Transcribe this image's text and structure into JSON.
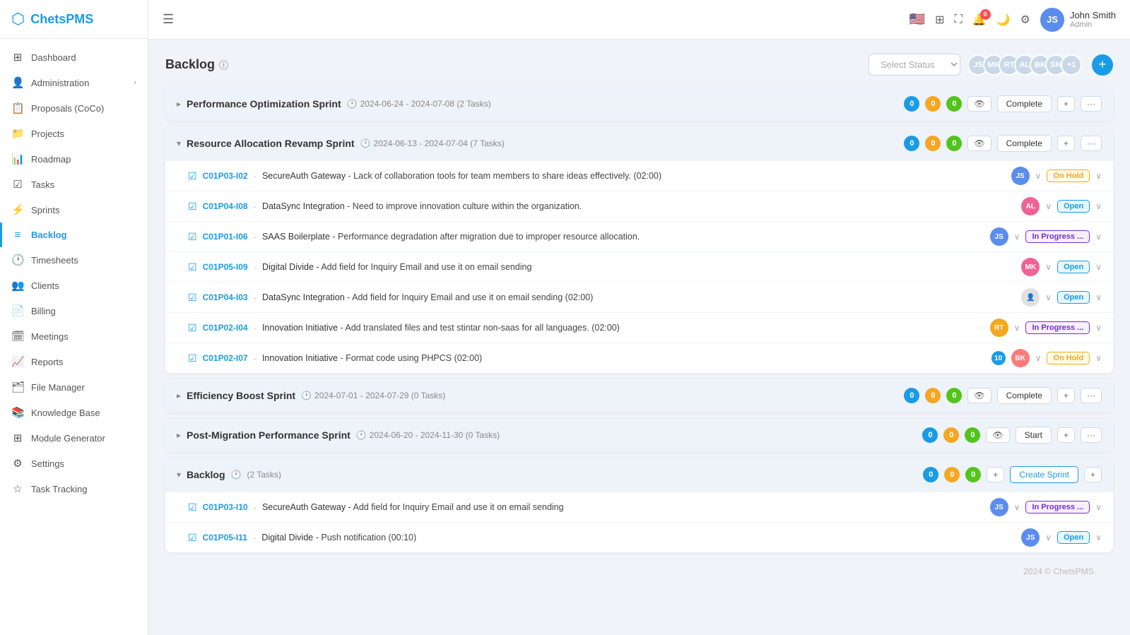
{
  "app": {
    "name": "ChetsPMS"
  },
  "header": {
    "menu_label": "☰",
    "user": {
      "name": "John Smith",
      "role": "Admin"
    },
    "notification_count": "0"
  },
  "sidebar": {
    "items": [
      {
        "id": "dashboard",
        "label": "Dashboard",
        "icon": "⊞"
      },
      {
        "id": "administration",
        "label": "Administration",
        "icon": "👤",
        "arrow": "›"
      },
      {
        "id": "proposals",
        "label": "Proposals (CoCo)",
        "icon": "📋"
      },
      {
        "id": "projects",
        "label": "Projects",
        "icon": "📁"
      },
      {
        "id": "roadmap",
        "label": "Roadmap",
        "icon": "📊"
      },
      {
        "id": "tasks",
        "label": "Tasks",
        "icon": "☑"
      },
      {
        "id": "sprints",
        "label": "Sprints",
        "icon": "⚡"
      },
      {
        "id": "backlog",
        "label": "Backlog",
        "icon": "≡",
        "active": true
      },
      {
        "id": "timesheets",
        "label": "Timesheets",
        "icon": "🕐"
      },
      {
        "id": "clients",
        "label": "Clients",
        "icon": "👥"
      },
      {
        "id": "billing",
        "label": "Billing",
        "icon": "📄"
      },
      {
        "id": "meetings",
        "label": "Meetings",
        "icon": "🗓"
      },
      {
        "id": "reports",
        "label": "Reports",
        "icon": "📈"
      },
      {
        "id": "file-manager",
        "label": "File Manager",
        "icon": "🗂"
      },
      {
        "id": "knowledge-base",
        "label": "Knowledge Base",
        "icon": "📚"
      },
      {
        "id": "module-generator",
        "label": "Module Generator",
        "icon": "⊞"
      },
      {
        "id": "settings",
        "label": "Settings",
        "icon": "⚙"
      },
      {
        "id": "task-tracking",
        "label": "Task Tracking",
        "icon": "☆"
      }
    ]
  },
  "page": {
    "title": "Backlog",
    "select_status_placeholder": "Select Status",
    "avatars": [
      "JS",
      "MK",
      "RT",
      "AL",
      "BK",
      "SN",
      "+"
    ],
    "footer": "2024 © ChetsPMS."
  },
  "sprints": [
    {
      "id": "sprint1",
      "name": "Performance Optimization Sprint",
      "dates": "2024-06-24 - 2024-07-08",
      "task_count": "2 Tasks",
      "expanded": false,
      "counts": [
        0,
        0,
        0
      ],
      "action": "Complete",
      "tasks": []
    },
    {
      "id": "sprint2",
      "name": "Resource Allocation Revamp Sprint",
      "dates": "2024-06-13 - 2024-07-04",
      "task_count": "7 Tasks",
      "expanded": true,
      "counts": [
        0,
        0,
        0
      ],
      "action": "Complete",
      "tasks": [
        {
          "id": "C01P03-I02",
          "project": "SecureAuth Gateway",
          "description": "Lack of collaboration tools for team members to share ideas effectively. (02:00)",
          "avatar": "JS",
          "avatar_class": "av-blue",
          "status": "On Hold",
          "status_class": "status-on-hold"
        },
        {
          "id": "C01P04-I08",
          "project": "DataSync Integration",
          "description": "Need to improve innovation culture within the organization.",
          "avatar": "AL",
          "avatar_class": "av-pink",
          "status": "Open",
          "status_class": "status-open"
        },
        {
          "id": "C01P01-I06",
          "project": "SAAS Boilerplate",
          "description": "Performance degradation after migration due to improper resource allocation.",
          "avatar": "JS",
          "avatar_class": "av-blue",
          "status": "In Progress ...",
          "status_class": "status-in-progress"
        },
        {
          "id": "C01P05-I09",
          "project": "Digital Divide",
          "description": "Add field for Inquiry Email and use it on email sending",
          "avatar": "MK",
          "avatar_class": "av-pink",
          "status": "Open",
          "status_class": "status-open"
        },
        {
          "id": "C01P04-I03",
          "project": "DataSync Integration",
          "description": "Add field for Inquiry Email and use it on email sending (02:00)",
          "avatar": "",
          "avatar_class": "task-avatar-unassigned",
          "status": "Open",
          "status_class": "status-open"
        },
        {
          "id": "C01P02-I04",
          "project": "Innovation Initiative",
          "description": "Add translated files and test stintar non-saas for all languages. (02:00)",
          "avatar": "RT",
          "avatar_class": "av-orange",
          "status": "In Progress ...",
          "status_class": "status-in-progress"
        },
        {
          "id": "C01P02-I07",
          "project": "Innovation Initiative",
          "description": "Format code using PHPCS (02:00)",
          "avatar": "10",
          "avatar_class": "av-blue",
          "count_badge": "10",
          "avatar2": "BK",
          "avatar2_class": "av-red",
          "status": "On Hold",
          "status_class": "status-on-hold"
        }
      ]
    },
    {
      "id": "sprint3",
      "name": "Efficiency Boost Sprint",
      "dates": "2024-07-01 - 2024-07-29",
      "task_count": "0 Tasks",
      "expanded": false,
      "counts": [
        0,
        0,
        0
      ],
      "action": "Complete",
      "tasks": []
    },
    {
      "id": "sprint4",
      "name": "Post-Migration Performance Sprint",
      "dates": "2024-06-20 - 2024-11-30",
      "task_count": "0 Tasks",
      "expanded": false,
      "counts": [
        0,
        0,
        0
      ],
      "action": "Start",
      "tasks": []
    },
    {
      "id": "backlog",
      "name": "Backlog",
      "dates": "",
      "task_count": "2 Tasks",
      "expanded": true,
      "counts": [
        0,
        0,
        0
      ],
      "is_backlog": true,
      "tasks": [
        {
          "id": "C01P03-I10",
          "project": "SecureAuth Gateway",
          "description": "Add field for Inquiry Email and use it on email sending",
          "avatar": "JS",
          "avatar_class": "av-blue",
          "status": "In Progress ...",
          "status_class": "status-in-progress"
        },
        {
          "id": "C01P05-I11",
          "project": "Digital Divide",
          "description": "Push notification (00:10)",
          "avatar": "JS",
          "avatar_class": "av-blue",
          "status": "Open",
          "status_class": "status-open"
        }
      ]
    }
  ]
}
